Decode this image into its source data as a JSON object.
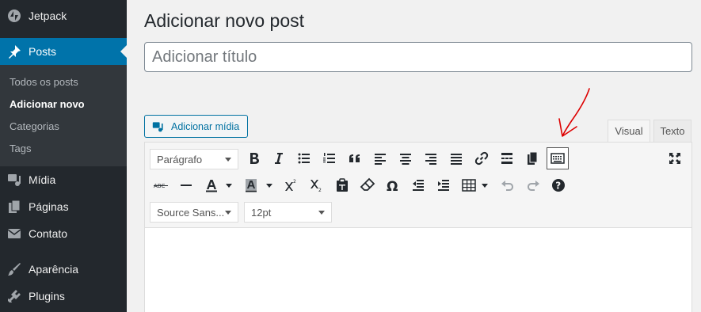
{
  "sidebar": {
    "items": [
      {
        "label": "Jetpack",
        "icon": "jetpack-icon"
      },
      {
        "label": "Posts",
        "icon": "pushpin-icon"
      },
      {
        "label": "Mídia",
        "icon": "media-icon"
      },
      {
        "label": "Páginas",
        "icon": "pages-icon"
      },
      {
        "label": "Contato",
        "icon": "envelope-icon"
      },
      {
        "label": "Aparência",
        "icon": "brush-icon"
      },
      {
        "label": "Plugins",
        "icon": "plugin-icon"
      }
    ],
    "submenu": [
      "Todos os posts",
      "Adicionar novo",
      "Categorias",
      "Tags"
    ]
  },
  "page": {
    "title": "Adicionar novo post",
    "title_placeholder": "Adicionar título"
  },
  "editor": {
    "add_media_label": "Adicionar mídia",
    "tabs": [
      "Visual",
      "Texto"
    ],
    "format_select": "Parágrafo",
    "font_select": "Source Sans...",
    "size_select": "12pt"
  },
  "colors": {
    "sidebar_bg": "#23282d",
    "accent": "#0073aa",
    "annotation": "#dd0000"
  }
}
